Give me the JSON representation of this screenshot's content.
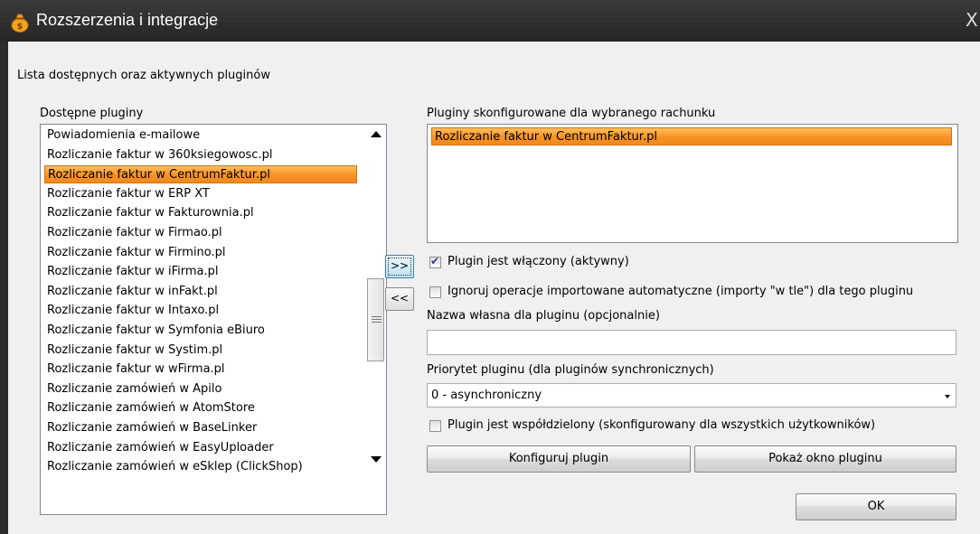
{
  "window": {
    "title": "Rozszerzenia i integracje",
    "close_glyph": "X",
    "icon": "money-bag-icon"
  },
  "intro_label": "Lista dostępnych oraz aktywnych pluginów",
  "available": {
    "label": "Dostępne pluginy",
    "items": [
      "Powiadomienia e-mailowe",
      "Rozliczanie faktur w 360ksiegowosc.pl",
      "Rozliczanie faktur w CentrumFaktur.pl",
      "Rozliczanie faktur w ERP XT",
      "Rozliczanie faktur w Fakturownia.pl",
      "Rozliczanie faktur w Firmao.pl",
      "Rozliczanie faktur w Firmino.pl",
      "Rozliczanie faktur w iFirma.pl",
      "Rozliczanie faktur w inFakt.pl",
      "Rozliczanie faktur w Intaxo.pl",
      "Rozliczanie faktur w Symfonia eBiuro",
      "Rozliczanie faktur w Systim.pl",
      "Rozliczanie faktur w wFirma.pl",
      "Rozliczanie zamówień w Apilo",
      "Rozliczanie zamówień w AtomStore",
      "Rozliczanie zamówień w BaseLinker",
      "Rozliczanie zamówień w EasyUploader",
      "Rozliczanie zamówień w eSklep (ClickShop)"
    ],
    "selected_index": 2
  },
  "buttons": {
    "add": ">>",
    "remove": "<<",
    "configure": "Konfiguruj plugin",
    "show_window": "Pokaż okno pluginu",
    "ok": "OK"
  },
  "configured": {
    "label": "Pluginy skonfigurowane dla wybranego rachunku",
    "items": [
      "Rozliczanie faktur w CentrumFaktur.pl"
    ]
  },
  "options": {
    "enabled_label": "Plugin jest włączony (aktywny)",
    "enabled_checked": true,
    "ignore_label": "Ignoruj operacje importowane automatyczne (importy \"w tle\") dla tego pluginu",
    "ignore_checked": false,
    "name_label": "Nazwa własna dla pluginu (opcjonalnie)",
    "name_value": "",
    "priority_label": "Priorytet pluginu (dla pluginów synchronicznych)",
    "priority_value": "0 - asynchroniczny",
    "shared_label": "Plugin jest współdzielony (skonfigurowany dla wszystkich użytkowników)",
    "shared_checked": false
  },
  "colors": {
    "selection": "#f99225",
    "titlebar": "#2b2b2b"
  }
}
